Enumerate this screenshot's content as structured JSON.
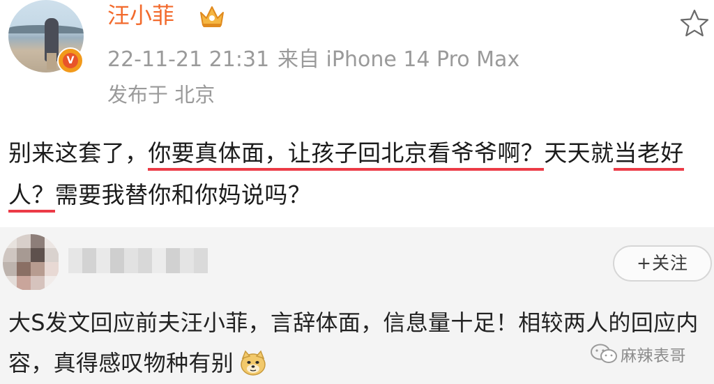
{
  "post": {
    "author": "汪小菲",
    "time": "22-11-21 21:31",
    "source": "来自 iPhone 14 Pro Max",
    "location": "发布于 北京",
    "text_part1": "别来这套了，",
    "text_part2": "你要真体面，让孩子回北京看爷爷啊？",
    "text_part3": "天天就",
    "text_part4": "当老好人？",
    "text_part5": "需要我替你和你妈说吗？",
    "verified_badge": "V",
    "colors": {
      "name": "#f26a2c",
      "meta": "#9a9a9a",
      "underline": "#ec3b47",
      "badge": "#f29a1b"
    },
    "icons": [
      "crown-icon",
      "star-icon",
      "verified-v-icon"
    ]
  },
  "repost": {
    "follow_label": "+关注",
    "text": "大S发文回应前夫汪小菲，言辞体面，信息量十足！相较两人的回应内容，真得感叹物种有别",
    "emoji": "doge-emoji-icon",
    "watermark": "麻辣表哥",
    "watermark_icon": "wechat-icon"
  }
}
